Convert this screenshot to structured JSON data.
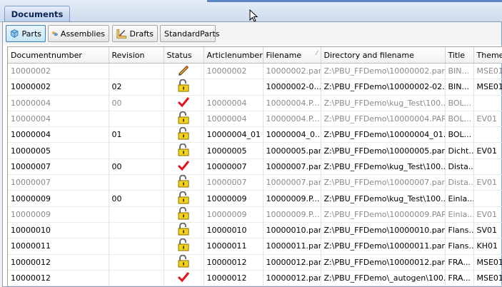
{
  "window": {
    "tab_label": "Documents"
  },
  "toolbar": {
    "buttons": [
      {
        "label": "Parts",
        "icon": "part-cube-icon",
        "active": true
      },
      {
        "label": "Assemblies",
        "icon": "assembly-icon",
        "active": false
      },
      {
        "label": "Drafts",
        "icon": "draft-icon",
        "active": false
      },
      {
        "label": "StandardParts",
        "icon": "",
        "active": false
      }
    ]
  },
  "table": {
    "columns": [
      "Documentnumber",
      "Revision",
      "Status",
      "Articlenumber",
      "Filename",
      "Directory and filename",
      "Title",
      "Theme"
    ],
    "sorted_column": "Filename",
    "rows": [
      {
        "doc": "10000002",
        "rev": "",
        "status": "pencil",
        "article": "10000002",
        "file": "10000002.par",
        "dir": "Z:\\PBU_FFDemo\\10000002.par",
        "title": "BIN...",
        "theme": "MSE01",
        "dim": true
      },
      {
        "doc": "10000002",
        "rev": "02",
        "status": "lock",
        "article": "",
        "file": "10000002-0...",
        "dir": "Z:\\PBU_FFDemo\\10000002-02....",
        "title": "BIN...",
        "theme": "MSE01",
        "dim": false
      },
      {
        "doc": "10000004",
        "rev": "00",
        "status": "check",
        "article": "10000004",
        "file": "10000004.P...",
        "dir": "Z:\\PBU_FFDemo\\kug_Test\\100...",
        "title": "BOL...",
        "theme": "",
        "dim": true
      },
      {
        "doc": "10000004",
        "rev": "",
        "status": "lock",
        "article": "10000004",
        "file": "10000004.P...",
        "dir": "Z:\\PBU_FFDemo\\10000004.PAR",
        "title": "BOL...",
        "theme": "EV01",
        "dim": true
      },
      {
        "doc": "10000004",
        "rev": "01",
        "status": "lock",
        "article": "10000004_01",
        "file": "10000004_0...",
        "dir": "Z:\\PBU_FFDemo\\10000004_01....",
        "title": "BOL...",
        "theme": "",
        "dim": false
      },
      {
        "doc": "10000005",
        "rev": "",
        "status": "lock",
        "article": "10000005",
        "file": "10000005.par",
        "dir": "Z:\\PBU_FFDemo\\10000005.par",
        "title": "Dicht...",
        "theme": "EV01",
        "dim": false
      },
      {
        "doc": "10000007",
        "rev": "00",
        "status": "check",
        "article": "10000007",
        "file": "10000007.par",
        "dir": "Z:\\PBU_FFDemo\\kug_Test\\100...",
        "title": "Dista...",
        "theme": "",
        "dim": false
      },
      {
        "doc": "10000007",
        "rev": "",
        "status": "lock",
        "article": "10000007",
        "file": "10000007.par",
        "dir": "Z:\\PBU_FFDemo\\10000007.par",
        "title": "Dista...",
        "theme": "EV01",
        "dim": true
      },
      {
        "doc": "10000009",
        "rev": "00",
        "status": "lock",
        "article": "10000009",
        "file": "10000009.P...",
        "dir": "Z:\\PBU_FFDemo\\kug_Test\\100...",
        "title": "Einla...",
        "theme": "",
        "dim": false
      },
      {
        "doc": "10000009",
        "rev": "",
        "status": "lock",
        "article": "10000009",
        "file": "10000009.P...",
        "dir": "Z:\\PBU_FFDemo\\10000009.PAR",
        "title": "Einla...",
        "theme": "EV01",
        "dim": true
      },
      {
        "doc": "10000010",
        "rev": "",
        "status": "lock",
        "article": "10000010",
        "file": "10000010.par",
        "dir": "Z:\\PBU_FFDemo\\10000010.par",
        "title": "Flans...",
        "theme": "SV01",
        "dim": false
      },
      {
        "doc": "10000011",
        "rev": "",
        "status": "lock",
        "article": "10000011",
        "file": "10000011.par",
        "dir": "Z:\\PBU_FFDemo\\10000011.par",
        "title": "Flans...",
        "theme": "KH01",
        "dim": false
      },
      {
        "doc": "10000012",
        "rev": "",
        "status": "lock",
        "article": "10000012",
        "file": "10000012.par",
        "dir": "Z:\\PBU_FFDemo\\10000012.par",
        "title": "FRA...",
        "theme": "MSE01",
        "dim": false
      },
      {
        "doc": "10000012",
        "rev": "",
        "status": "check",
        "article": "10000012",
        "file": "10000012.par",
        "dir": "Z:\\PBU_FFDemo\\_autogen\\100...",
        "title": "FRA...",
        "theme": "MSE01",
        "dim": false
      }
    ]
  }
}
